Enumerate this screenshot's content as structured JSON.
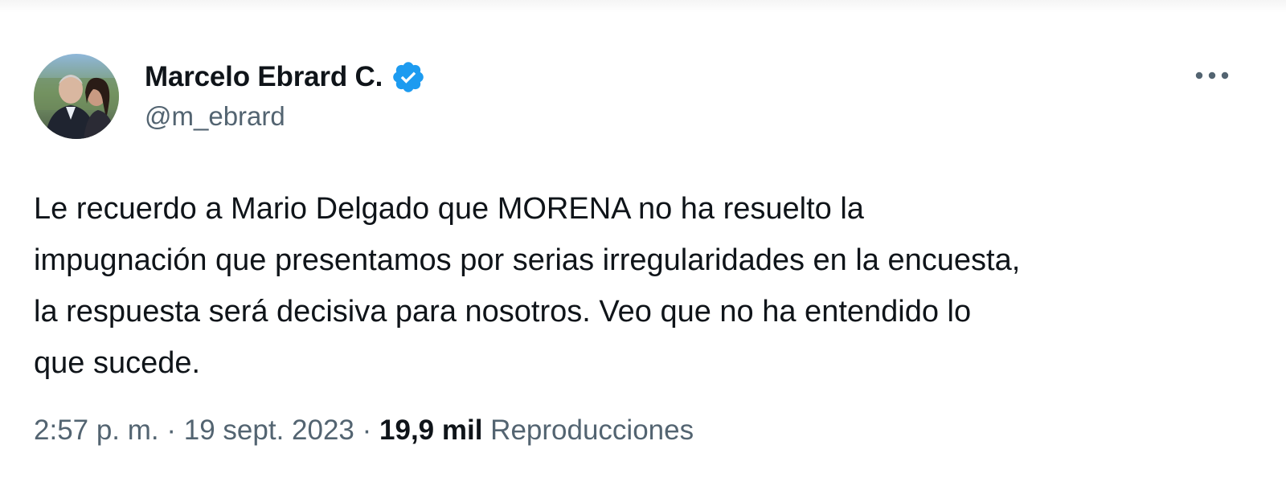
{
  "user": {
    "display_name": "Marcelo Ebrard C.",
    "handle": "@m_ebrard",
    "verified": true
  },
  "tweet": {
    "lines": [
      "Le recuerdo a Mario Delgado que MORENA no ha resuelto la",
      "impugnación que presentamos por serias irregularidades en la encuesta,",
      "la respuesta será decisiva para nosotros. Veo que no ha entendido lo",
      "que sucede."
    ],
    "time": "2:57 p. m.",
    "separator": "·",
    "date": "19 sept. 2023",
    "views_count": "19,9 mil",
    "views_label": "Reproducciones"
  },
  "icons": {
    "verified": "verified-badge-icon",
    "more": "more-options-icon"
  },
  "colors": {
    "text_primary": "#0f1419",
    "text_secondary": "#536471",
    "verified_blue": "#1d9bf0"
  }
}
